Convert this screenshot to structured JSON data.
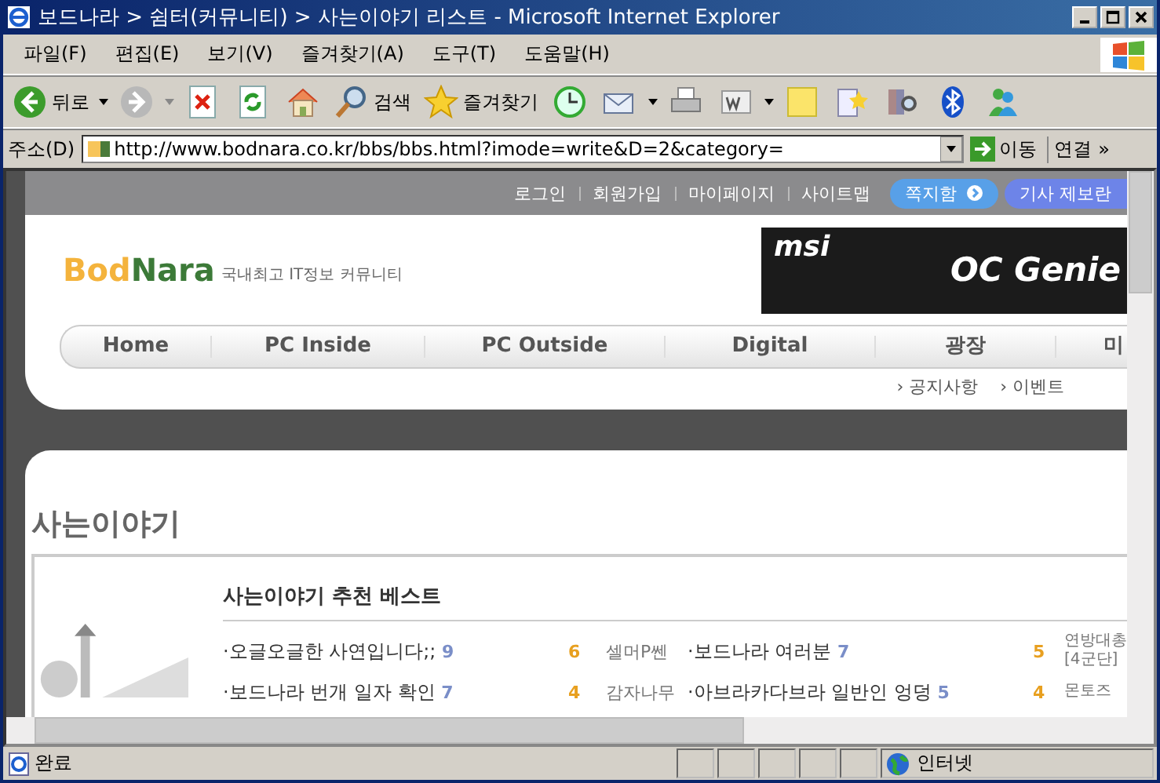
{
  "window": {
    "title": "보드나라 > 쉼터(커뮤니티) > 사는이야기 리스트 - Microsoft Internet Explorer"
  },
  "menu": [
    "파일(F)",
    "편집(E)",
    "보기(V)",
    "즐겨찾기(A)",
    "도구(T)",
    "도움말(H)"
  ],
  "toolbar": {
    "back_label": "뒤로",
    "search_label": "검색",
    "favorites_label": "즐겨찾기"
  },
  "address": {
    "label": "주소(D)",
    "url": "http://www.bodnara.co.kr/bbs/bbs.html?imode=write&D=2&category=",
    "go_label": "이동",
    "links_label": "연결",
    "links_chevron": "»"
  },
  "page": {
    "top_links": [
      "로그인",
      "회원가입",
      "마이페이지",
      "사이트맵"
    ],
    "top_buttons": [
      "쪽지함",
      "기사 제보란"
    ],
    "logo": {
      "first": "Bod",
      "second": "Nara",
      "tagline": "국내최고 IT정보 커뮤니티"
    },
    "banner": {
      "brand": "msi",
      "product": "OC Genie"
    },
    "nav": [
      "Home",
      "PC Inside",
      "PC Outside",
      "Digital",
      "광장",
      "미"
    ],
    "subnav": [
      "› 공지사항",
      "› 이벤트"
    ],
    "section_title": "사는이야기",
    "best_title": "사는이야기 추천 베스트",
    "rows": [
      {
        "title": "·오글오글한 사연입니다;;",
        "comments": "9",
        "votes": "6",
        "author": "셀머P쎈",
        "title_2": "·보드나라 여러분",
        "comments_2": "7",
        "votes_2": "5",
        "author_2": "연방대총[4군단]"
      },
      {
        "title": "·보드나라 번개 일자 확인",
        "comments": "7",
        "votes": "4",
        "author": "감자나무",
        "title_2": "·아브라카다브라 일반인 엉덩",
        "comments_2": "5",
        "votes_2": "4",
        "author_2": "몬토즈"
      }
    ]
  },
  "status": {
    "text": "완료",
    "zone": "인터넷"
  }
}
